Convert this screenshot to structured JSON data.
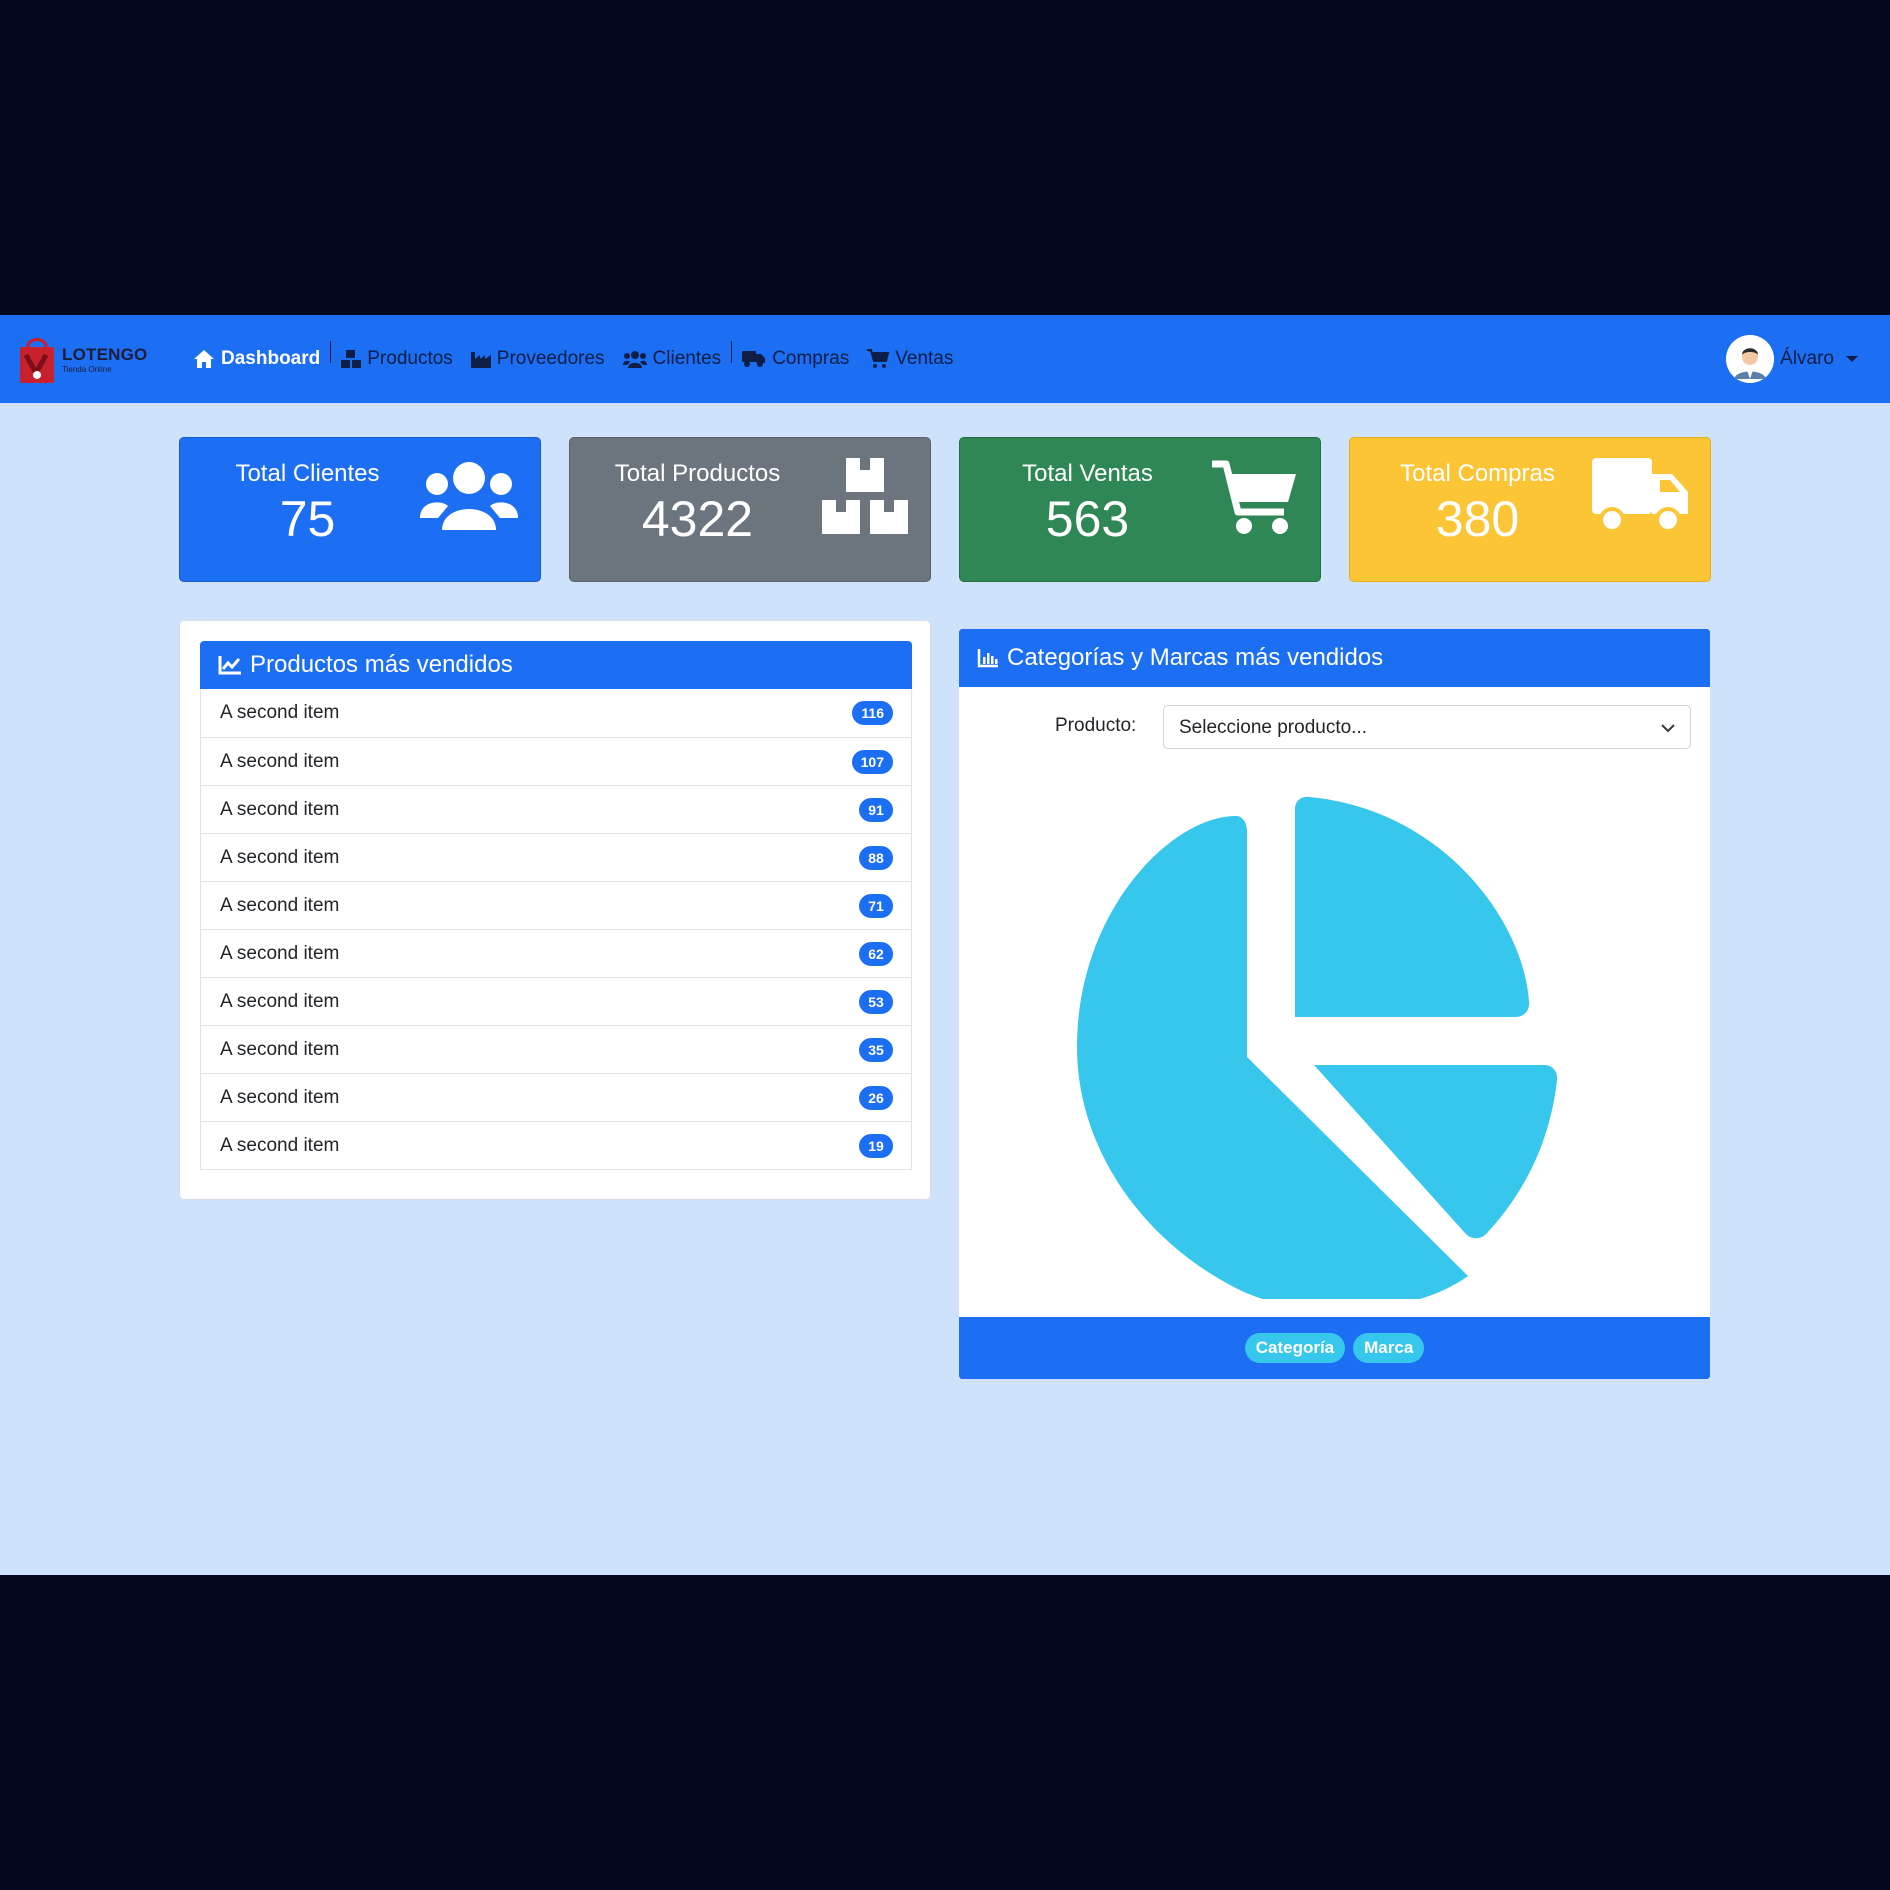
{
  "brand": {
    "name": "LOTENGO",
    "tagline": "Tienda Online"
  },
  "nav": {
    "items": [
      {
        "label": "Dashboard",
        "icon": "home-icon",
        "active": true
      },
      {
        "label": "Productos",
        "icon": "boxes-icon"
      },
      {
        "label": "Proveedores",
        "icon": "industry-icon"
      },
      {
        "label": "Clientes",
        "icon": "users-icon"
      },
      {
        "label": "Compras",
        "icon": "truck-icon"
      },
      {
        "label": "Ventas",
        "icon": "cart-icon"
      }
    ]
  },
  "user": {
    "name": "Álvaro",
    "avatar": "user-avatar-icon"
  },
  "stats": [
    {
      "label": "Total Clientes",
      "value": "75",
      "icon": "users-icon",
      "color": "#1c6ef2"
    },
    {
      "label": "Total Productos",
      "value": "4322",
      "icon": "boxes-icon",
      "color": "#6c757d"
    },
    {
      "label": "Total Ventas",
      "value": "563",
      "icon": "cart-icon",
      "color": "#2e8754"
    },
    {
      "label": "Total Compras",
      "value": "380",
      "icon": "truck-icon",
      "color": "#fcc536"
    }
  ],
  "top_products": {
    "title": "Productos más vendidos",
    "icon": "chart-line-icon",
    "items": [
      {
        "label": "A second item",
        "count": "116"
      },
      {
        "label": "A second item",
        "count": "107"
      },
      {
        "label": "A second item",
        "count": "91"
      },
      {
        "label": "A second item",
        "count": "88"
      },
      {
        "label": "A second item",
        "count": "71"
      },
      {
        "label": "A second item",
        "count": "62"
      },
      {
        "label": "A second item",
        "count": "53"
      },
      {
        "label": "A second item",
        "count": "35"
      },
      {
        "label": "A second item",
        "count": "26"
      },
      {
        "label": "A second item",
        "count": "19"
      }
    ]
  },
  "categories": {
    "title": "Categorías y Marcas más vendidos",
    "icon": "chart-bar-icon",
    "select_label": "Producto:",
    "select_value": "Seleccione producto...",
    "pie_icon": "pie-chart-icon",
    "pie_color": "#38c7ec",
    "footer_tabs": [
      "Categoría",
      "Marca"
    ]
  },
  "colors": {
    "primary": "#1c6ef2",
    "background": "#cfe2fb",
    "badge": "#1c6ef2"
  }
}
